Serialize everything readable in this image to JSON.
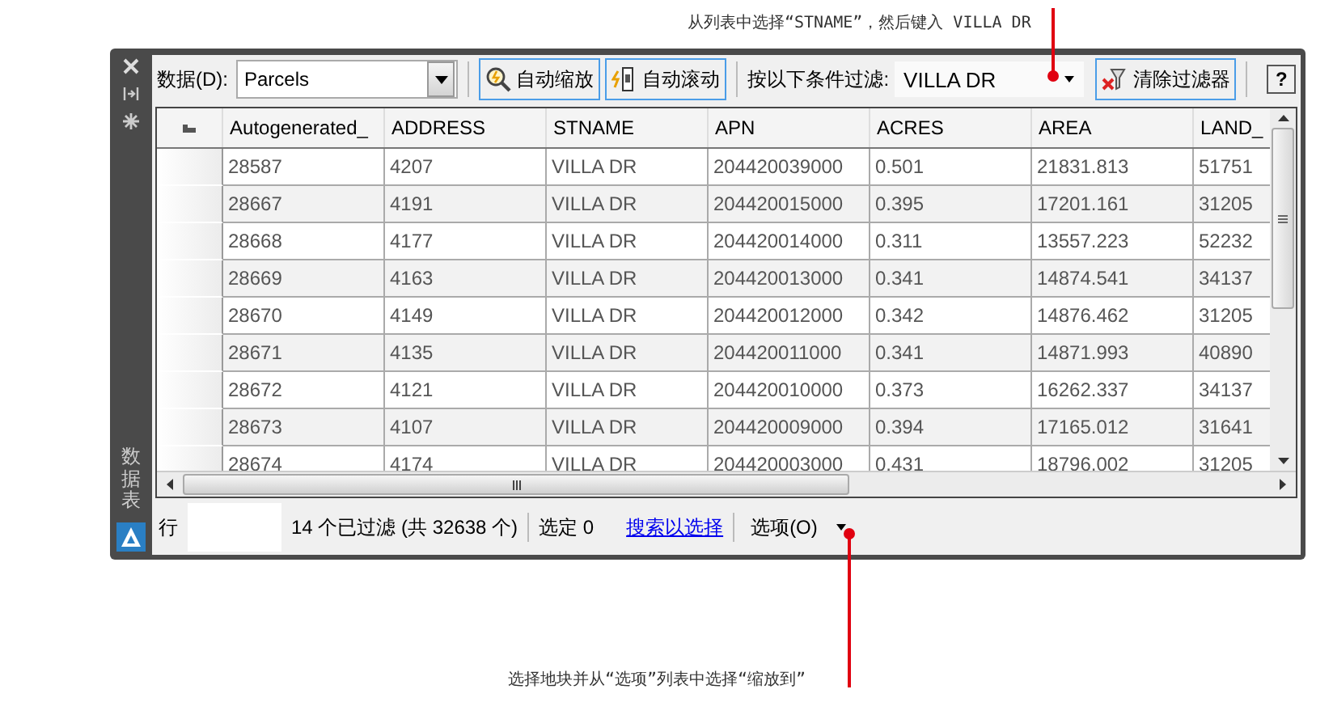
{
  "annotations": [
    {
      "kind": "top",
      "text": "从列表中选择“STNAME”，然后键入 VILLA DR"
    },
    {
      "kind": "bottom",
      "text": "选择地块并从“选项”列表中选择“缩放到”"
    }
  ],
  "palette": {
    "side_title": "数据表",
    "toolbar": {
      "data_label": "数据(D):",
      "data_value": "Parcels",
      "buttons": [
        {
          "kind": "zoom",
          "label": "自动缩放"
        },
        {
          "kind": "scroll",
          "label": "自动滚动"
        }
      ],
      "filter_label": "按以下条件过滤:",
      "filter_value": "VILLA DR",
      "clear_button": "清除过滤器",
      "help_button": "?"
    },
    "table": {
      "columns": [
        "Autogenerated_",
        "ADDRESS",
        "STNAME",
        "APN",
        "ACRES",
        "AREA",
        "LAND_"
      ],
      "rows": [
        [
          "28587",
          "4207",
          "VILLA DR",
          "204420039000",
          "0.501",
          "21831.813",
          "51751"
        ],
        [
          "28667",
          "4191",
          "VILLA DR",
          "204420015000",
          "0.395",
          "17201.161",
          "31205"
        ],
        [
          "28668",
          "4177",
          "VILLA DR",
          "204420014000",
          "0.311",
          "13557.223",
          "52232"
        ],
        [
          "28669",
          "4163",
          "VILLA DR",
          "204420013000",
          "0.341",
          "14874.541",
          "34137"
        ],
        [
          "28670",
          "4149",
          "VILLA DR",
          "204420012000",
          "0.342",
          "14876.462",
          "31205"
        ],
        [
          "28671",
          "4135",
          "VILLA DR",
          "204420011000",
          "0.341",
          "14871.993",
          "40890"
        ],
        [
          "28672",
          "4121",
          "VILLA DR",
          "204420010000",
          "0.373",
          "16262.337",
          "34137"
        ],
        [
          "28673",
          "4107",
          "VILLA DR",
          "204420009000",
          "0.394",
          "17165.012",
          "31641"
        ],
        [
          "28674",
          "4174",
          "VILLA DR",
          "204420003000",
          "0.431",
          "18796.002",
          "31205"
        ]
      ]
    },
    "status_bar": {
      "row_label": "行",
      "filter_count": "14 个已过滤 (共 32638 个)",
      "selected": "选定 0",
      "link": "搜索以选择",
      "options": "选项(O)"
    }
  }
}
